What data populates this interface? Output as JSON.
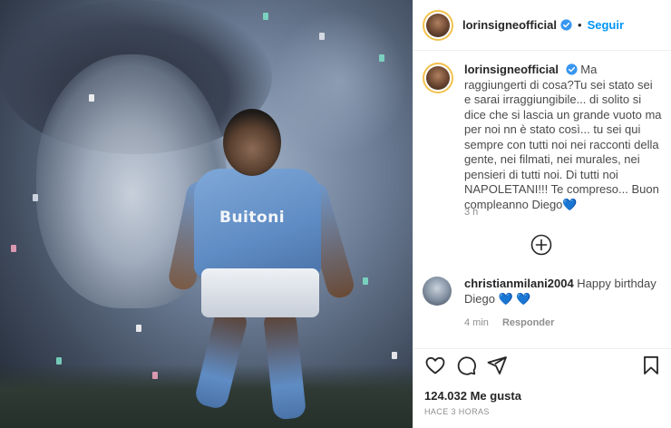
{
  "post": {
    "username": "lorinsigneofficial",
    "follow_label": "Seguir",
    "dot": "•",
    "caption_user": "lorinsigneofficial",
    "caption_text": "Ma raggiungerti di cosa?Tu sei stato sei e sarai irraggiungibile... di solito si dice che si lascia un grande vuoto ma per noi nn è stato così... tu sei qui sempre con tutti noi nei racconti della gente, nei filmati, nei murales, nei pensieri di tutti noi. Di tutti noi NAPOLETANI!!! Te compreso... Buon compleanno Diego",
    "caption_emoji": "💙",
    "caption_time": "3 h",
    "photo_sponsor": "Buitoni"
  },
  "comment": {
    "username": "christianmilani2004",
    "text": "Happy birthday Diego",
    "emoji": "💙 💙",
    "time": "4 min",
    "reply_label": "Responder"
  },
  "footer": {
    "likes": "124.032 Me gusta",
    "posted": "HACE 3 HORAS"
  },
  "colors": {
    "accent": "#0095f6",
    "verified": "#3897f0",
    "heart_blue": "#1c6fd6"
  },
  "icons": [
    "verified-icon",
    "add-comment-icon",
    "heart-icon",
    "comment-icon",
    "share-icon",
    "bookmark-icon"
  ]
}
